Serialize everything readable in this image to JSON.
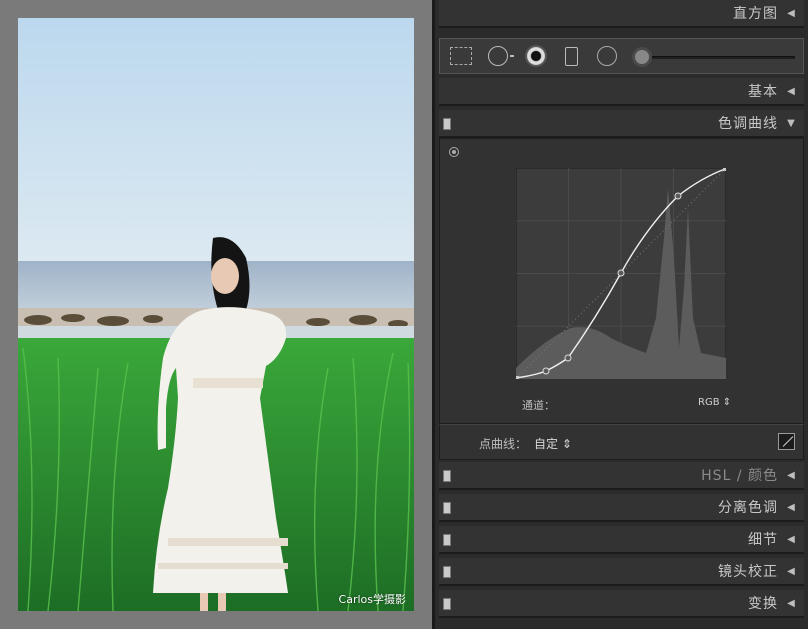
{
  "watermark": "Carlos学摄影",
  "panels": {
    "histogram": "直方图",
    "basic": "基本",
    "tone_curve": "色调曲线",
    "hsl": "HSL",
    "hsl_sep": " / ",
    "hsl_color": "颜色",
    "split_toning": "分离色调",
    "detail": "细节",
    "lens_correction": "镜头校正",
    "transform": "变换"
  },
  "tool_icons": [
    "crop-icon",
    "spot-removal-icon",
    "red-eye-icon",
    "graduated-filter-icon",
    "radial-filter-icon",
    "adjustment-brush-icon"
  ],
  "tone_curve": {
    "channel_label": "通道：",
    "channel_value": "RGB ⇕",
    "point_curve_label": "点曲线：",
    "point_curve_value": "自定 ⇕"
  },
  "collapse_icon": "◀",
  "expand_icon": "▼"
}
